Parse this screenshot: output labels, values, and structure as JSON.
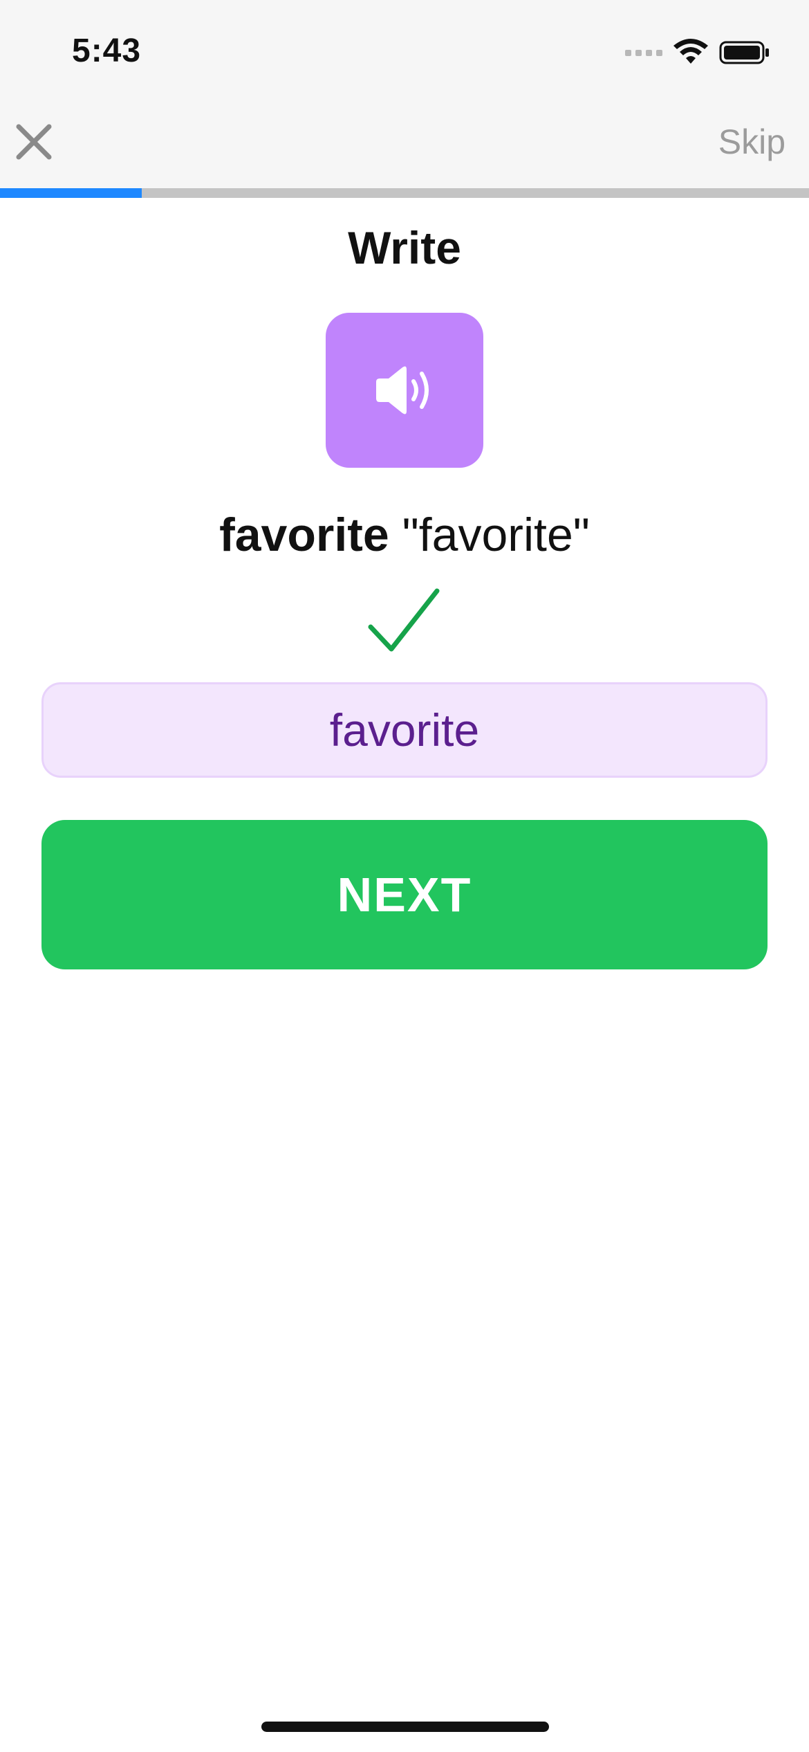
{
  "status_bar": {
    "time": "5:43",
    "signal_icon": "cellular-signal-icon",
    "wifi_icon": "wifi-icon",
    "battery_icon": "battery-icon"
  },
  "nav": {
    "close_icon": "close-icon",
    "skip_label": "Skip"
  },
  "progress": {
    "value": 0.175,
    "fill_color": "#1e88ff",
    "track_color": "#c4c4c4"
  },
  "exercise": {
    "title": "Write",
    "audio_icon": "speaker-icon",
    "word": "favorite",
    "word_quoted": "\"favorite\"",
    "result_icon": "checkmark-icon",
    "answer_value": "favorite"
  },
  "actions": {
    "next_label": "NEXT"
  },
  "colors": {
    "audio_button": "#c084fc",
    "answer_bg": "#f3e6fd",
    "answer_text": "#5b1f8e",
    "next_button": "#22c55e",
    "check": "#16a34a"
  }
}
